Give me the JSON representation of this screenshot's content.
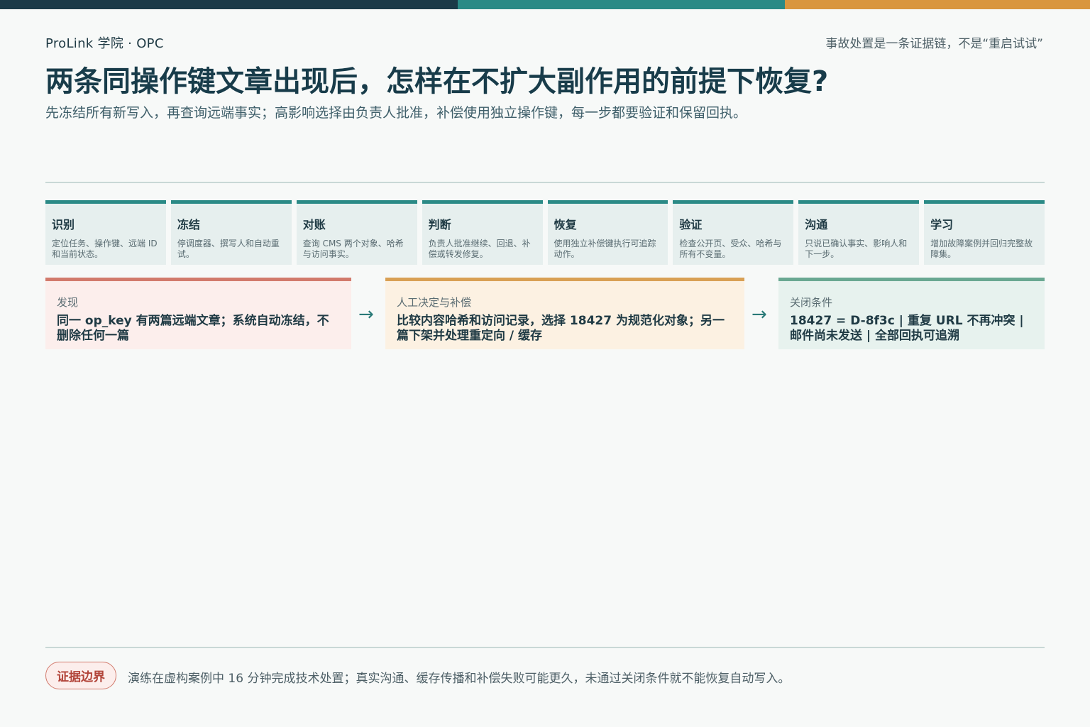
{
  "header": {
    "brand": "ProLink 学院 · OPC",
    "tagline": "事故处置是一条证据链，不是“重启试试”",
    "title": "两条同操作键文章出现后，怎样在不扩大副作用的前提下恢复?",
    "subtitle": "先冻结所有新写入，再查询远端事实；高影响选择由负责人批准，补偿使用独立操作键，每一步都要验证和保留回执。"
  },
  "steps": [
    {
      "title": "识别",
      "desc": "定位任务、操作键、远端 ID 和当前状态。"
    },
    {
      "title": "冻结",
      "desc": "停调度器、撰写人和自动重试。"
    },
    {
      "title": "对账",
      "desc": "查询 CMS 两个对象、哈希与访问事实。"
    },
    {
      "title": "判断",
      "desc": "负责人批准继续、回退、补偿或转发修复。"
    },
    {
      "title": "恢复",
      "desc": "使用独立补偿键执行可追踪动作。"
    },
    {
      "title": "验证",
      "desc": "检查公开页、受众、哈希与所有不变量。"
    },
    {
      "title": "沟通",
      "desc": "只说已确认事实、影响人和下一步。"
    },
    {
      "title": "学习",
      "desc": "增加故障案例并回归完整故障集。"
    }
  ],
  "flow": {
    "a": {
      "label": "发现",
      "text": "同一 op_key 有两篇远端文章；系统自动冻结，不删除任何一篇"
    },
    "b": {
      "label": "人工决定与补偿",
      "text": "比较内容哈希和访问记录，选择 18427 为规范化对象；另一篇下架并处理重定向 / 缓存"
    },
    "c": {
      "label": "关闭条件",
      "text": "18427 = D-8f3c | 重复 URL 不再冲突 | 邮件尚未发送 | 全部回执可追溯"
    },
    "arrow": "→"
  },
  "footer": {
    "badge": "证据边界",
    "text": "演练在虚构案例中 16 分钟完成技术处置；真实沟通、缓存传播和补偿失败可能更久，未通过关闭条件就不能恢复自动写入。"
  },
  "colors": {
    "primary": "#1b3a48",
    "teal": "#2a8a86",
    "amber": "#d9963f",
    "red": "#d27a6c",
    "green": "#6aa892"
  }
}
